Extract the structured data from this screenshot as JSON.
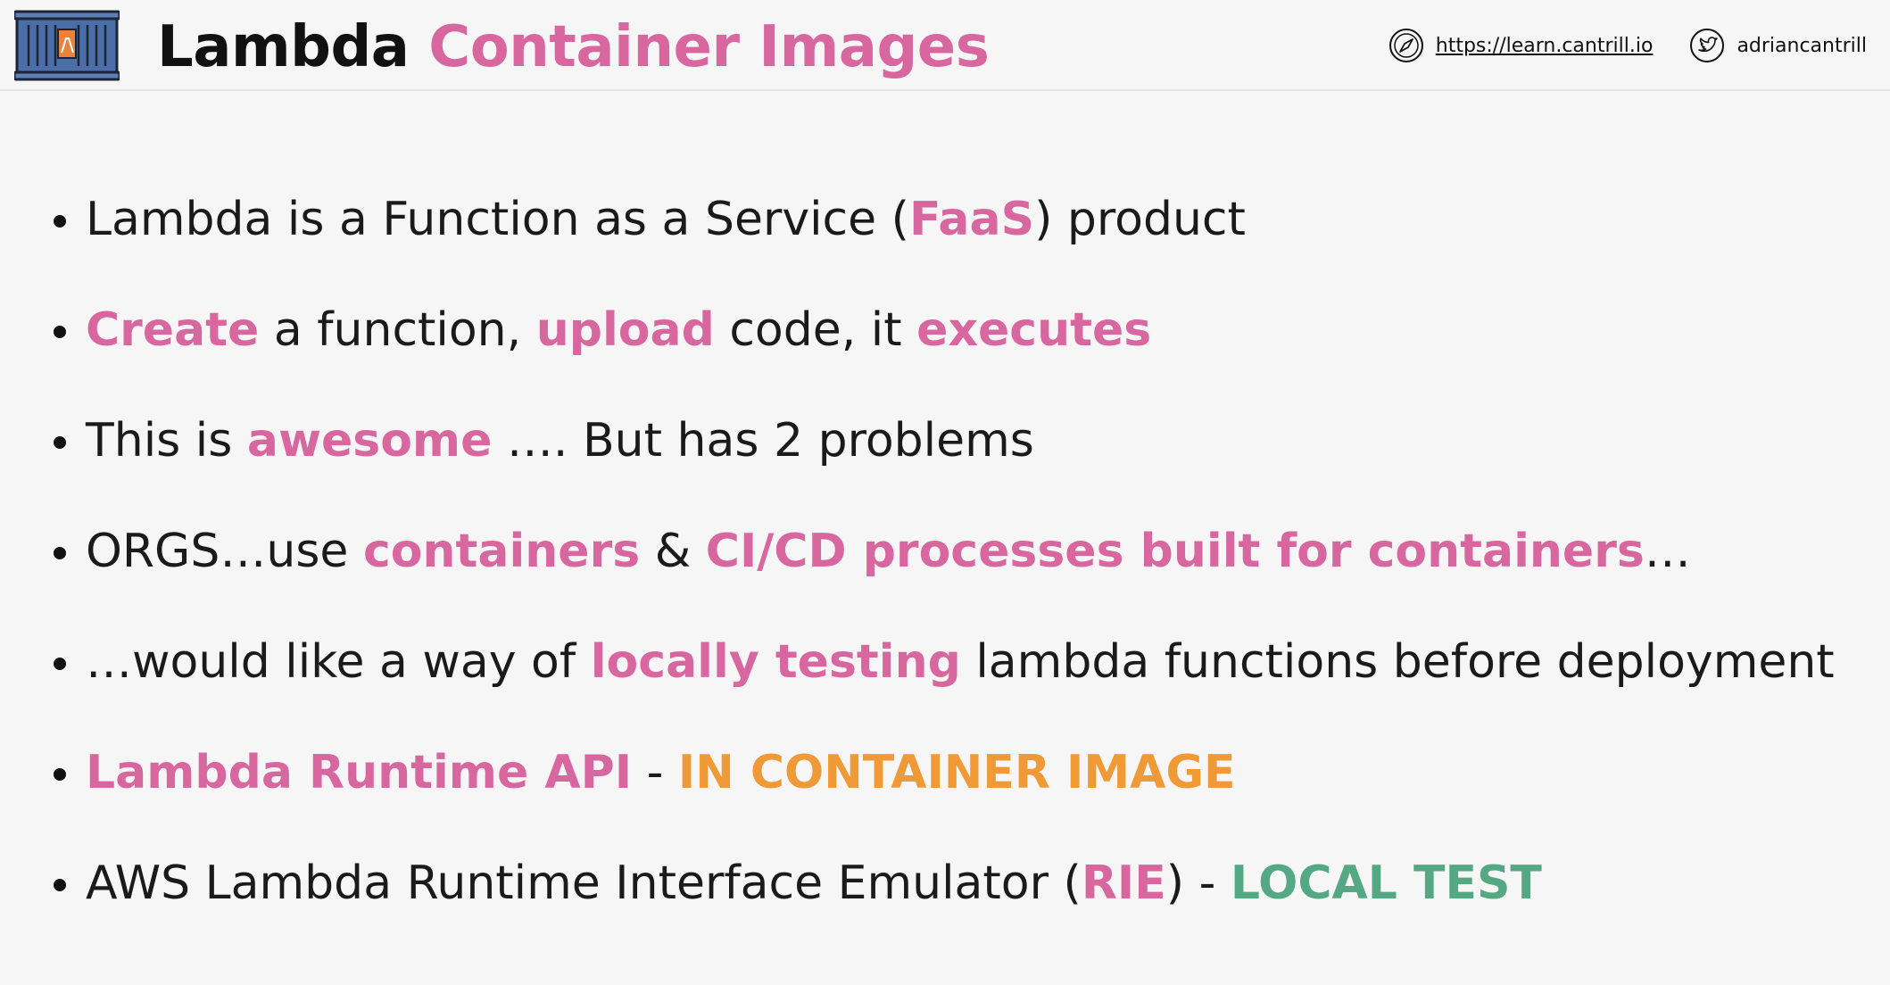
{
  "header": {
    "title_part1": "Lambda",
    "title_part2": "Container Images",
    "website_url": "https://learn.cantrill.io",
    "twitter_handle": "adriancantrill",
    "logo_icon": "lambda-container-icon",
    "website_icon": "compass-icon",
    "twitter_icon": "twitter-bird-icon"
  },
  "colors": {
    "pink_accent": "#d9679f",
    "orange_accent": "#ef9a36",
    "green_accent": "#55a884",
    "text": "#1a1a1a",
    "background": "#f6f6f6"
  },
  "bullets": [
    {
      "p1": "Lambda is a Function as a Service (",
      "h1": "FaaS",
      "p2": ") product"
    },
    {
      "h1": "Create",
      "p1": " a function, ",
      "h2": "upload",
      "p2": " code, it ",
      "h3": "executes"
    },
    {
      "p1": "This is ",
      "h1": "awesome",
      "p2": " …. But has 2 problems"
    },
    {
      "p1": "ORGS…use ",
      "h1": "containers",
      "p2": " & ",
      "h2": "CI/CD processes built for containers",
      "p3": "…"
    },
    {
      "p1": "…would like a way of ",
      "h1": "locally testing",
      "p2": " lambda functions before deployment"
    },
    {
      "h1": "Lambda Runtime API",
      "p1": " - ",
      "h2": "IN CONTAINER IMAGE"
    },
    {
      "p1": "AWS Lambda Runtime Interface Emulator (",
      "h1": "RIE",
      "p2": ") - ",
      "h2": "LOCAL TEST"
    }
  ]
}
